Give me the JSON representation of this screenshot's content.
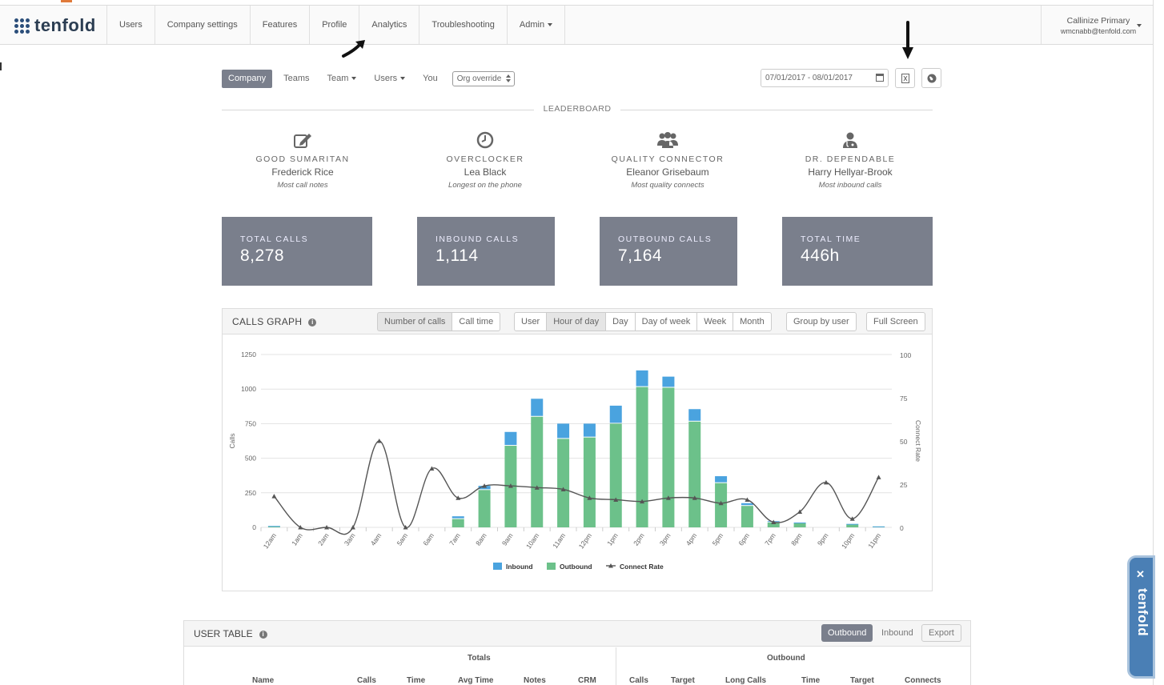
{
  "nav": {
    "brand": "tenfold",
    "items": [
      "Users",
      "Company settings",
      "Features",
      "Profile",
      "Analytics",
      "Troubleshooting",
      "Admin"
    ],
    "account_name": "Callinize Primary",
    "account_email": "wmcnabb@tenfold.com"
  },
  "filters": {
    "tabs": [
      "Company",
      "Teams",
      "Team",
      "Users",
      "You"
    ],
    "active": "Company",
    "org_select": "Org override",
    "date_range": "07/01/2017 - 08/01/2017"
  },
  "leaderboard": {
    "title": "LEADERBOARD",
    "awards": [
      {
        "title": "GOOD SUMARITAN",
        "name": "Frederick Rice",
        "desc": "Most call notes",
        "icon": "edit-icon"
      },
      {
        "title": "OVERCLOCKER",
        "name": "Lea Black",
        "desc": "Longest on the phone",
        "icon": "clock-icon"
      },
      {
        "title": "QUALITY CONNECTOR",
        "name": "Eleanor Grisebaum",
        "desc": "Most quality connects",
        "icon": "users-icon"
      },
      {
        "title": "DR. DEPENDABLE",
        "name": "Harry Hellyar-Brook",
        "desc": "Most inbound calls",
        "icon": "doctor-icon"
      }
    ]
  },
  "stats": [
    {
      "label": "TOTAL CALLS",
      "value": "8,278"
    },
    {
      "label": "INBOUND CALLS",
      "value": "1,114"
    },
    {
      "label": "OUTBOUND CALLS",
      "value": "7,164"
    },
    {
      "label": "TOTAL TIME",
      "value": "446h"
    }
  ],
  "graph": {
    "title": "CALLS GRAPH",
    "metric_buttons": [
      "Number of calls",
      "Call time"
    ],
    "period_buttons": [
      "User",
      "Hour of day",
      "Day",
      "Day of week",
      "Week",
      "Month"
    ],
    "group_button": "Group by user",
    "fullscreen_button": "Full Screen"
  },
  "chart_data": {
    "type": "bar",
    "categories": [
      "12am",
      "1am",
      "2am",
      "3am",
      "4am",
      "5am",
      "6am",
      "7am",
      "8am",
      "9am",
      "10am",
      "11am",
      "12pm",
      "1pm",
      "2pm",
      "3pm",
      "4pm",
      "5pm",
      "6pm",
      "7pm",
      "8pm",
      "9pm",
      "10pm",
      "11pm"
    ],
    "series": [
      {
        "name": "Inbound",
        "type": "bar",
        "stack": "calls",
        "color": "#4aa3df",
        "values": [
          2,
          0,
          0,
          0,
          0,
          0,
          0,
          20,
          30,
          100,
          130,
          110,
          100,
          130,
          120,
          80,
          90,
          50,
          20,
          10,
          5,
          0,
          5,
          2
        ]
      },
      {
        "name": "Outbound",
        "type": "bar",
        "stack": "calls",
        "color": "#6cc18a",
        "values": [
          8,
          0,
          0,
          0,
          0,
          0,
          0,
          60,
          270,
          590,
          800,
          640,
          650,
          750,
          1015,
          1010,
          765,
          320,
          155,
          35,
          30,
          0,
          20,
          5
        ]
      },
      {
        "name": "Connect Rate",
        "type": "line",
        "axis": "right",
        "color": "#555555",
        "values": [
          18,
          0,
          0,
          0,
          50,
          0,
          34,
          17,
          24,
          24,
          23,
          22,
          17,
          16,
          15,
          17,
          17,
          14,
          16,
          3,
          9,
          26,
          5,
          29
        ]
      }
    ],
    "ylabel": "Calls",
    "y2label": "Connect Rate",
    "ylim": [
      0,
      1250
    ],
    "y2lim": [
      0,
      100
    ],
    "yticks": [
      0,
      250,
      500,
      750,
      1000,
      1250
    ],
    "y2ticks": [
      0,
      25,
      50,
      75,
      100
    ],
    "legend": "bottom-center",
    "grid": true
  },
  "user_table": {
    "title": "USER TABLE",
    "toggle": [
      "Outbound",
      "Inbound"
    ],
    "export": "Export",
    "groups": [
      "Totals",
      "Outbound"
    ],
    "columns_totals": [
      "Name",
      "Calls",
      "Time",
      "Avg Time",
      "Notes",
      "CRM"
    ],
    "columns_outbound": [
      "Calls",
      "Target",
      "Long Calls",
      "Time",
      "Target",
      "Connects"
    ]
  },
  "widget": {
    "close": "✕",
    "brand": "tenfold"
  }
}
